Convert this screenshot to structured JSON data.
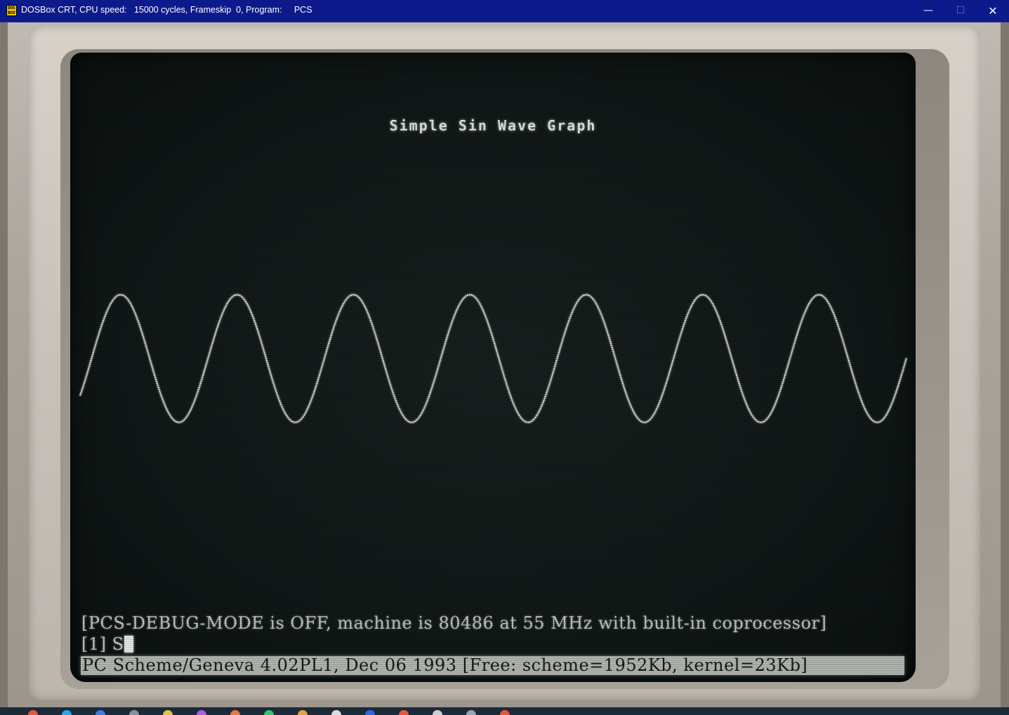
{
  "window": {
    "title_app": "DOSBox CRT, CPU speed:",
    "title_cycles": "15000 cycles, Frameskip  0, Program:",
    "title_program": "PCS",
    "icon_text": "DOS BOX",
    "minimize_glyph": "—",
    "maximize_glyph": "☐",
    "close_glyph": "✕"
  },
  "screen": {
    "graph_title": "Simple Sin Wave Graph",
    "console_line_1": "[PCS-DEBUG-MODE is OFF, machine is 80486 at 55 MHz with built-in coprocessor]",
    "prompt": "[1] S",
    "status_line": "PC Scheme/Geneva 4.02PL1, Dec 06 1993 [Free: scheme=1952Kb, kernel=23Kb]"
  },
  "colors": {
    "titlebar": "#0d1a8c",
    "screen_bg": "#111918",
    "phosphor": "#e9ece6",
    "status_bg": "#b9bcb6"
  },
  "chart_data": {
    "type": "line",
    "title": "Simple Sin Wave Graph",
    "function": "sin",
    "cycles_shown": 7.1,
    "amplitude": 1,
    "ylim": [
      -1,
      1
    ],
    "baseline": 0,
    "grid": false
  },
  "taskbar": {
    "icons": [
      "chrome-icon",
      "edge-icon",
      "mail-icon",
      "terminal-icon",
      "folder-icon",
      "media-icon",
      "firefox-icon",
      "spotify-icon",
      "dosbox-icon",
      "notes-icon",
      "store-icon",
      "paint-icon",
      "settings-icon",
      "search-icon",
      "music-icon"
    ]
  }
}
